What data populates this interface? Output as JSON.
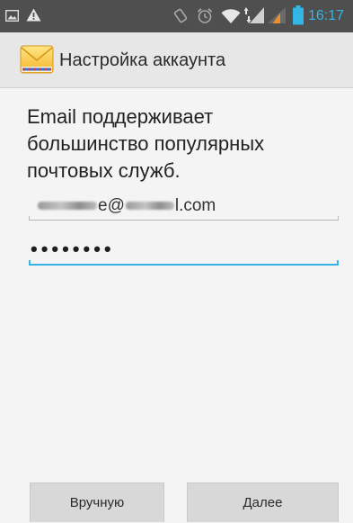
{
  "status_bar": {
    "time": "16:17",
    "left_icons": [
      "gallery-notification-icon",
      "warning-icon"
    ],
    "right_icons": [
      "rotate-icon",
      "alarm-icon",
      "wifi-icon",
      "mobile-data-icon",
      "signal-strength-icon",
      "battery-icon"
    ]
  },
  "action_bar": {
    "icon": "envelope-icon",
    "title": "Настройка аккаунта"
  },
  "intro": {
    "lines": [
      "Email поддерживает",
      "большинство популярных",
      "почтовых служб."
    ]
  },
  "email_field": {
    "visible_fragments": [
      "e@",
      "l.com"
    ]
  },
  "password_field": {
    "masked_value": "••••••••",
    "focused": true
  },
  "buttons": {
    "manual": "Вручную",
    "next": "Далее"
  },
  "colors": {
    "accent": "#33b5e5",
    "status_bar_bg": "#4f4f4f",
    "action_bar_bg": "#e7e7e7",
    "body_bg": "#f4f4f4",
    "button_bg": "#d8d8d8",
    "signal_orange": "#e8902a"
  }
}
